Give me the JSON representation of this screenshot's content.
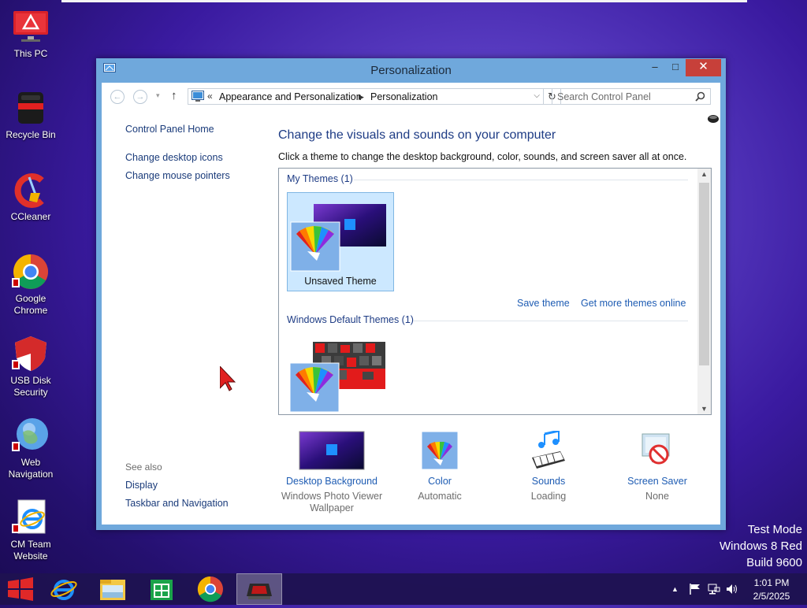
{
  "desktop": {
    "icons": [
      {
        "label": "This PC",
        "icon": "this-pc-icon"
      },
      {
        "label": "Recycle Bin",
        "icon": "recycle-bin-icon"
      },
      {
        "label": "CCleaner",
        "icon": "ccleaner-icon"
      },
      {
        "label": "Google Chrome",
        "icon": "chrome-icon"
      },
      {
        "label": "USB Disk Security",
        "icon": "shield-icon"
      },
      {
        "label": "Web Navigation",
        "icon": "globe-icon"
      },
      {
        "label": "CM Team Website",
        "icon": "ie-icon"
      }
    ],
    "watermark": [
      "Test Mode",
      "Windows 8 Red",
      "Build 9600"
    ]
  },
  "window": {
    "title": "Personalization",
    "controls": {
      "minimize": "–",
      "maximize": "□",
      "close": "✕"
    },
    "nav": {
      "back": "←",
      "forward": "→",
      "up": "↑",
      "breadcrumb": [
        "Appearance and Personalization",
        "Personalization"
      ],
      "overflow": "«",
      "search_placeholder": "Search Control Panel"
    },
    "left_pane": {
      "links": [
        "Control Panel Home",
        "Change desktop icons",
        "Change mouse pointers"
      ],
      "see_also_heading": "See also",
      "see_also": [
        "Display",
        "Taskbar and Navigation"
      ]
    },
    "main": {
      "title": "Change the visuals and sounds on your computer",
      "description": "Click a theme to change the desktop background, color, sounds, and screen saver all at once.",
      "my_themes_heading": "My Themes (1)",
      "my_themes": [
        {
          "name": "Unsaved Theme",
          "selected": true
        }
      ],
      "save_theme": "Save theme",
      "get_more": "Get more themes online",
      "default_themes_heading": "Windows Default Themes (1)"
    },
    "bottom": [
      {
        "label": "Desktop Background",
        "sub": "Windows Photo Viewer Wallpaper",
        "icon": "desktop-background-icon"
      },
      {
        "label": "Color",
        "sub": "Automatic",
        "icon": "color-icon"
      },
      {
        "label": "Sounds",
        "sub": "Loading",
        "icon": "sounds-icon"
      },
      {
        "label": "Screen Saver",
        "sub": "None",
        "icon": "screen-saver-icon"
      }
    ]
  },
  "taskbar": {
    "apps": [
      "start-icon",
      "internet-explorer-icon",
      "file-explorer-icon",
      "store-icon",
      "chrome-icon",
      "personalization-icon"
    ],
    "time": "1:01 PM",
    "date": "2/5/2025"
  },
  "colors": {
    "accent": "#6fa8dc",
    "link": "#1e5cb3",
    "close": "#c7403a"
  }
}
